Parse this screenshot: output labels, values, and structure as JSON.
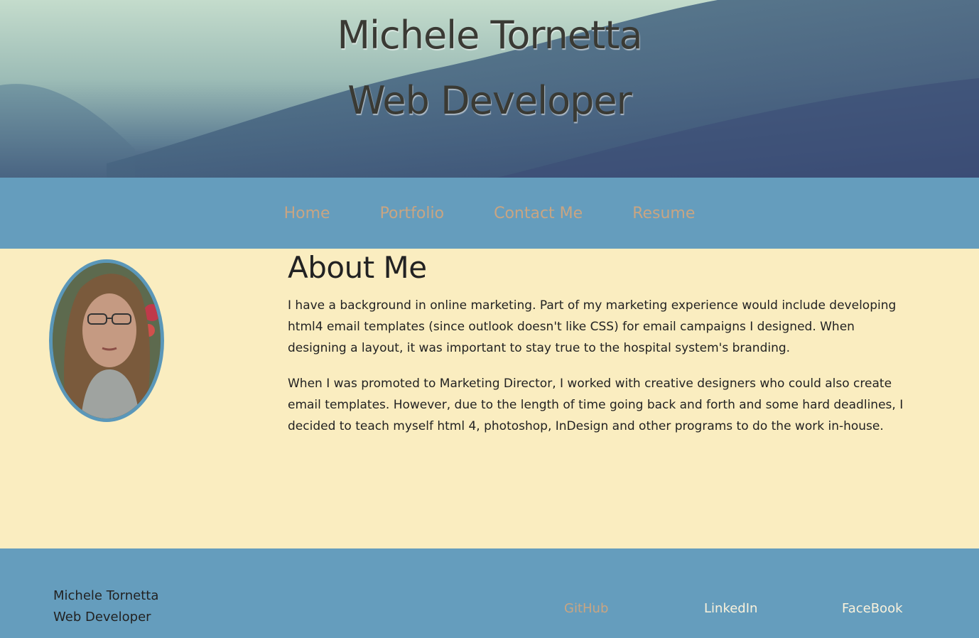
{
  "header": {
    "name": "Michele Tornetta",
    "role": "Web Developer"
  },
  "nav": {
    "items": [
      {
        "label": "Home"
      },
      {
        "label": "Portfolio"
      },
      {
        "label": "Contact Me"
      },
      {
        "label": "Resume"
      }
    ]
  },
  "about": {
    "heading": "About Me",
    "paragraphs": [
      "I have a background in online marketing. Part of my marketing experience would include developing html4 email templates (since outlook doesn't like CSS) for email campaigns I designed. When designing a layout, it was important to stay true to the hospital system's branding.",
      "When I was promoted to Marketing Director, I worked with creative designers who could also create email templates. However, due to the length of time going back and forth and some hard deadlines, I decided to teach myself html 4, photoshop, InDesign and other programs to do the work in-house."
    ]
  },
  "footer": {
    "name": "Michele Tornetta",
    "role": "Web Developer",
    "links": [
      {
        "label": "GitHub"
      },
      {
        "label": "LinkedIn"
      },
      {
        "label": "FaceBook"
      }
    ]
  },
  "colors": {
    "nav_background": "#659dbd",
    "page_background": "#faedc0",
    "nav_link": "#c9a582",
    "footer_link_light": "#faf2dc",
    "avatar_border": "#5a97b9"
  }
}
